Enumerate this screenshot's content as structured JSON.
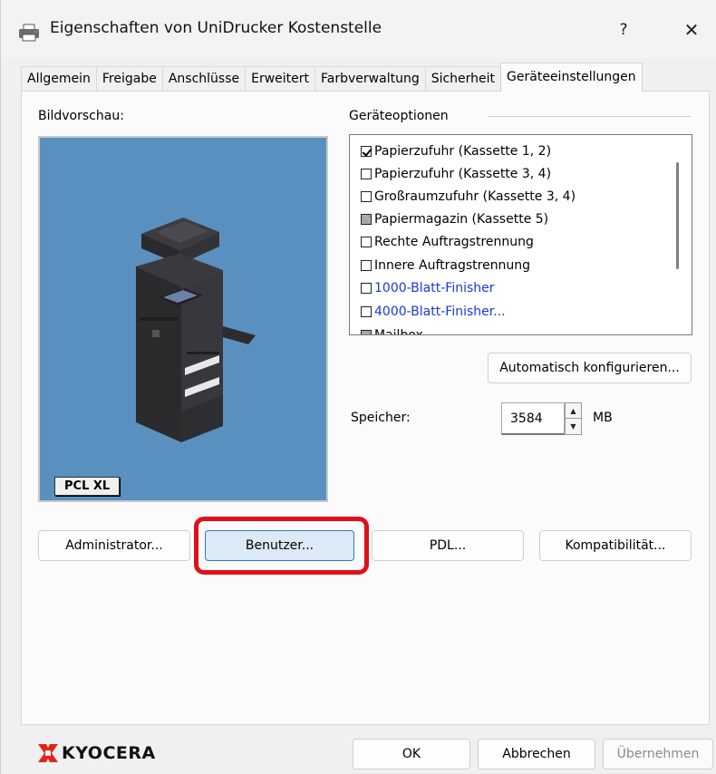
{
  "window": {
    "title": "Eigenschaften von UniDrucker Kostenstelle",
    "help_label": "?",
    "close_label": "✕"
  },
  "tabs": [
    {
      "label": "Allgemein",
      "active": false
    },
    {
      "label": "Freigabe",
      "active": false
    },
    {
      "label": "Anschlüsse",
      "active": false
    },
    {
      "label": "Erweitert",
      "active": false
    },
    {
      "label": "Farbverwaltung",
      "active": false
    },
    {
      "label": "Sicherheit",
      "active": false
    },
    {
      "label": "Geräteeinstellungen",
      "active": true
    }
  ],
  "preview": {
    "label": "Bildvorschau:",
    "badge": "PCL XL"
  },
  "options": {
    "label": "Geräteoptionen",
    "items": [
      {
        "label": "Papierzufuhr (Kassette 1, 2)",
        "state": "checked",
        "color": "default"
      },
      {
        "label": "Papierzufuhr (Kassette 3, 4)",
        "state": "unchecked",
        "color": "default"
      },
      {
        "label": "Großraumzufuhr (Kassette 3, 4)",
        "state": "unchecked",
        "color": "default"
      },
      {
        "label": "Papiermagazin (Kassette 5)",
        "state": "grey",
        "color": "default"
      },
      {
        "label": "Rechte Auftragstrennung",
        "state": "unchecked",
        "color": "default"
      },
      {
        "label": "Innere Auftragstrennung",
        "state": "unchecked",
        "color": "default"
      },
      {
        "label": "1000-Blatt-Finisher",
        "state": "unchecked",
        "color": "blue"
      },
      {
        "label": "4000-Blatt-Finisher...",
        "state": "unchecked",
        "color": "blue"
      },
      {
        "label": "Mailbox",
        "state": "grey",
        "color": "default"
      }
    ],
    "auto_configure_label": "Automatisch konfigurieren..."
  },
  "memory": {
    "label": "Speicher:",
    "value": "3584",
    "unit": "MB"
  },
  "buttons": {
    "administrator": "Administrator...",
    "benutzer": "Benutzer...",
    "pdl": "PDL...",
    "kompatibilitaet": "Kompatibilität..."
  },
  "footer": {
    "brand": "KYOCERA",
    "ok": "OK",
    "cancel": "Abbrechen",
    "apply": "Übernehmen"
  },
  "colors": {
    "preview_background": "#5a90bf",
    "highlight": "#e0101a",
    "link_blue": "#1a39d6",
    "brand_red": "#e2241a"
  }
}
